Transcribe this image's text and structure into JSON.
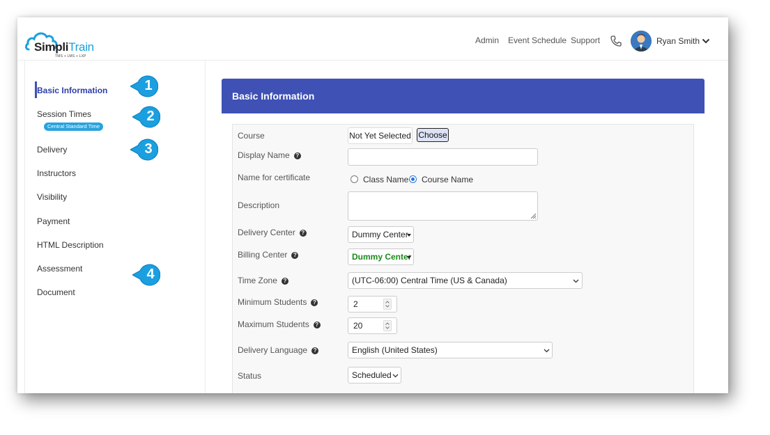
{
  "logo": {
    "name_part1": "Simpli",
    "name_part2": "Train",
    "tagline": "TMS + LMS + LXP"
  },
  "topnav": {
    "admin": "Admin",
    "event_schedule": "Event Schedule",
    "support": "Support",
    "user_name": "Ryan Smith"
  },
  "sidebar": {
    "items": [
      {
        "label": "Basic Information"
      },
      {
        "label": "Session Times"
      },
      {
        "label": "Delivery"
      },
      {
        "label": "Instructors"
      },
      {
        "label": "Visibility"
      },
      {
        "label": "Payment"
      },
      {
        "label": "HTML Description"
      },
      {
        "label": "Assessment"
      },
      {
        "label": "Document"
      }
    ],
    "session_badge": "Central Standard Time"
  },
  "callouts": [
    "1",
    "2",
    "3",
    "4"
  ],
  "panel": {
    "title": "Basic Information"
  },
  "form": {
    "course": {
      "label": "Course",
      "value": "Not Yet Selected",
      "button": "Choose"
    },
    "display_name": {
      "label": "Display Name",
      "value": ""
    },
    "cert_name": {
      "label": "Name for certificate",
      "option1": "Class Name",
      "option2": "Course Name",
      "selected": "Course Name"
    },
    "description": {
      "label": "Description",
      "value": ""
    },
    "delivery_center": {
      "label": "Delivery Center",
      "value": "Dummy Center"
    },
    "billing_center": {
      "label": "Billing Center",
      "value": "Dummy Center"
    },
    "time_zone": {
      "label": "Time Zone",
      "value": "(UTC-06:00) Central Time (US & Canada)"
    },
    "min_students": {
      "label": "Minimum Students",
      "value": "2"
    },
    "max_students": {
      "label": "Maximum Students",
      "value": "20"
    },
    "delivery_language": {
      "label": "Delivery Language",
      "value": "English (United States)"
    },
    "status": {
      "label": "Status",
      "value": "Scheduled"
    }
  },
  "colors": {
    "primary": "#3f51b5",
    "accent": "#1aa0dc",
    "callout": "#1a9fe0",
    "billing_text": "#1a8a1a"
  }
}
